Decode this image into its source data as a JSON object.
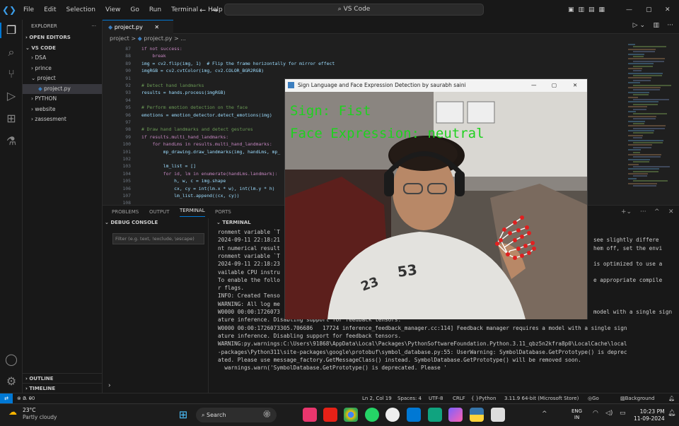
{
  "titlebar": {
    "menu": [
      "File",
      "Edit",
      "Selection",
      "View",
      "Go",
      "Run",
      "Terminal",
      "Help"
    ],
    "search": "VS Code"
  },
  "sidebar": {
    "header": "EXPLORER",
    "open_editors": "OPEN EDITORS",
    "root": "VS CODE",
    "items": [
      {
        "label": "DSA",
        "kind": "folder"
      },
      {
        "label": "prince",
        "kind": "folder"
      },
      {
        "label": "project",
        "kind": "folder-open"
      },
      {
        "label": "project.py",
        "kind": "file"
      },
      {
        "label": "PYTHON",
        "kind": "folder"
      },
      {
        "label": "website",
        "kind": "folder"
      },
      {
        "label": "zassesment",
        "kind": "folder"
      }
    ],
    "outline": "OUTLINE",
    "timeline": "TIMELINE"
  },
  "editor": {
    "tab": "project.py",
    "crumbs": [
      "project",
      ">",
      "project.py",
      ">",
      "..."
    ],
    "line_numbers": [
      "87",
      "88",
      "89",
      "90",
      "91",
      "92",
      "93",
      "94",
      "95",
      "96",
      "97",
      "98",
      "99",
      "100",
      "101",
      "102",
      "103",
      "104",
      "105",
      "106",
      "107",
      "108",
      "109",
      "110",
      "111"
    ],
    "lines": [
      "if not success:",
      "    break",
      "img = cv2.flip(img, 1)  # Flip the frame horizontally for mirror effect",
      "imgRGB = cv2.cvtColor(img, cv2.COLOR_BGR2RGB)",
      "",
      "# Detect hand landmarks",
      "results = hands.process(imgRGB)",
      "",
      "# Perform emotion detection on the face",
      "emotions = emotion_detector.detect_emotions(img)",
      "",
      "# Draw hand landmarks and detect gestures",
      "if results.multi_hand_landmarks:",
      "    for handLms in results.multi_hand_landmarks:",
      "        mp_drawing.draw_landmarks(img, handLms, mp_",
      "",
      "        lm_list = []",
      "        for id, lm in enumerate(handLms.landmark):",
      "            h, w, c = img.shape",
      "            cx, cy = int(lm.x * w), int(lm.y * h)",
      "            lm_list.append((cx, cy))",
      "",
      "        sign = detect_gesture(lm_list)",
      "        cv2.putText(img, f'Sign: {sign}', (10, 50)"
    ]
  },
  "panel": {
    "tabs": [
      "PROBLEMS",
      "OUTPUT",
      "TERMINAL",
      "PORTS"
    ],
    "debug_title": "DEBUG CONSOLE",
    "filter_placeholder": "Filter (e.g. text, !exclude, \\escape)",
    "terminal_title": "TERMINAL",
    "terminal_lines": [
      "ronment variable `T",
      "2024-09-11 22:18:21",
      "nt numerical result",
      "ronment variable `T",
      "2024-09-11 22:18:23",
      "vailable CPU instru",
      "To enable the follo",
      "r flags.",
      "INFO: Created Tenso",
      "WARNING: All log me",
      "W0000 00:00:1726073",
      "ature inference. Disabling support for feedback tensors.",
      "W0000 00:00:1726073305.706686   17724 inference_feedback_manager.cc:114] Feedback manager requires a model with a single sign",
      "ature inference. Disabling support for feedback tensors.",
      "WARNING:py.warnings:C:\\Users\\91868\\AppData\\Local\\Packages\\PythonSoftwareFoundation.Python.3.11_qbz5n2kfra8p0\\LocalCache\\local",
      "-packages\\Python311\\site-packages\\google\\protobuf\\symbol_database.py:55: UserWarning: SymbolDatabase.GetPrototype() is deprec",
      "ated. Please use message_factory.GetMessageClass() instead. SymbolDatabase.GetPrototype() will be removed soon.",
      "  warnings.warn('SymbolDatabase.GetPrototype() is deprecated. Please '"
    ],
    "right_fragments": [
      "see slightly differe",
      "hem off, set the envi",
      "is optimized to use a",
      "e appropriate compile",
      "model with a single sign"
    ]
  },
  "camera": {
    "title": "Sign Language and Face Expression Detection by saurabh saini",
    "sign": "Sign: Fist",
    "expression": "Face Expression: neutral"
  },
  "status": {
    "errors": "0",
    "warnings": "0",
    "ports": "0",
    "position": "Ln 2, Col 19",
    "spaces": "Spaces: 4",
    "encoding": "UTF-8",
    "eol": "CRLF",
    "language": "Python",
    "interpreter": "3.11.9 64-bit (Microsoft Store)",
    "golive": "Go Live",
    "background": "Background"
  },
  "taskbar": {
    "temp": "23°C",
    "weather": "Partly cloudy",
    "search": "Search",
    "lang1": "ENG",
    "lang2": "IN",
    "time": "10:23 PM",
    "date": "11-09-2024"
  },
  "colors": {
    "accent": "#0078d4",
    "sign_text": "#1fd11f"
  }
}
